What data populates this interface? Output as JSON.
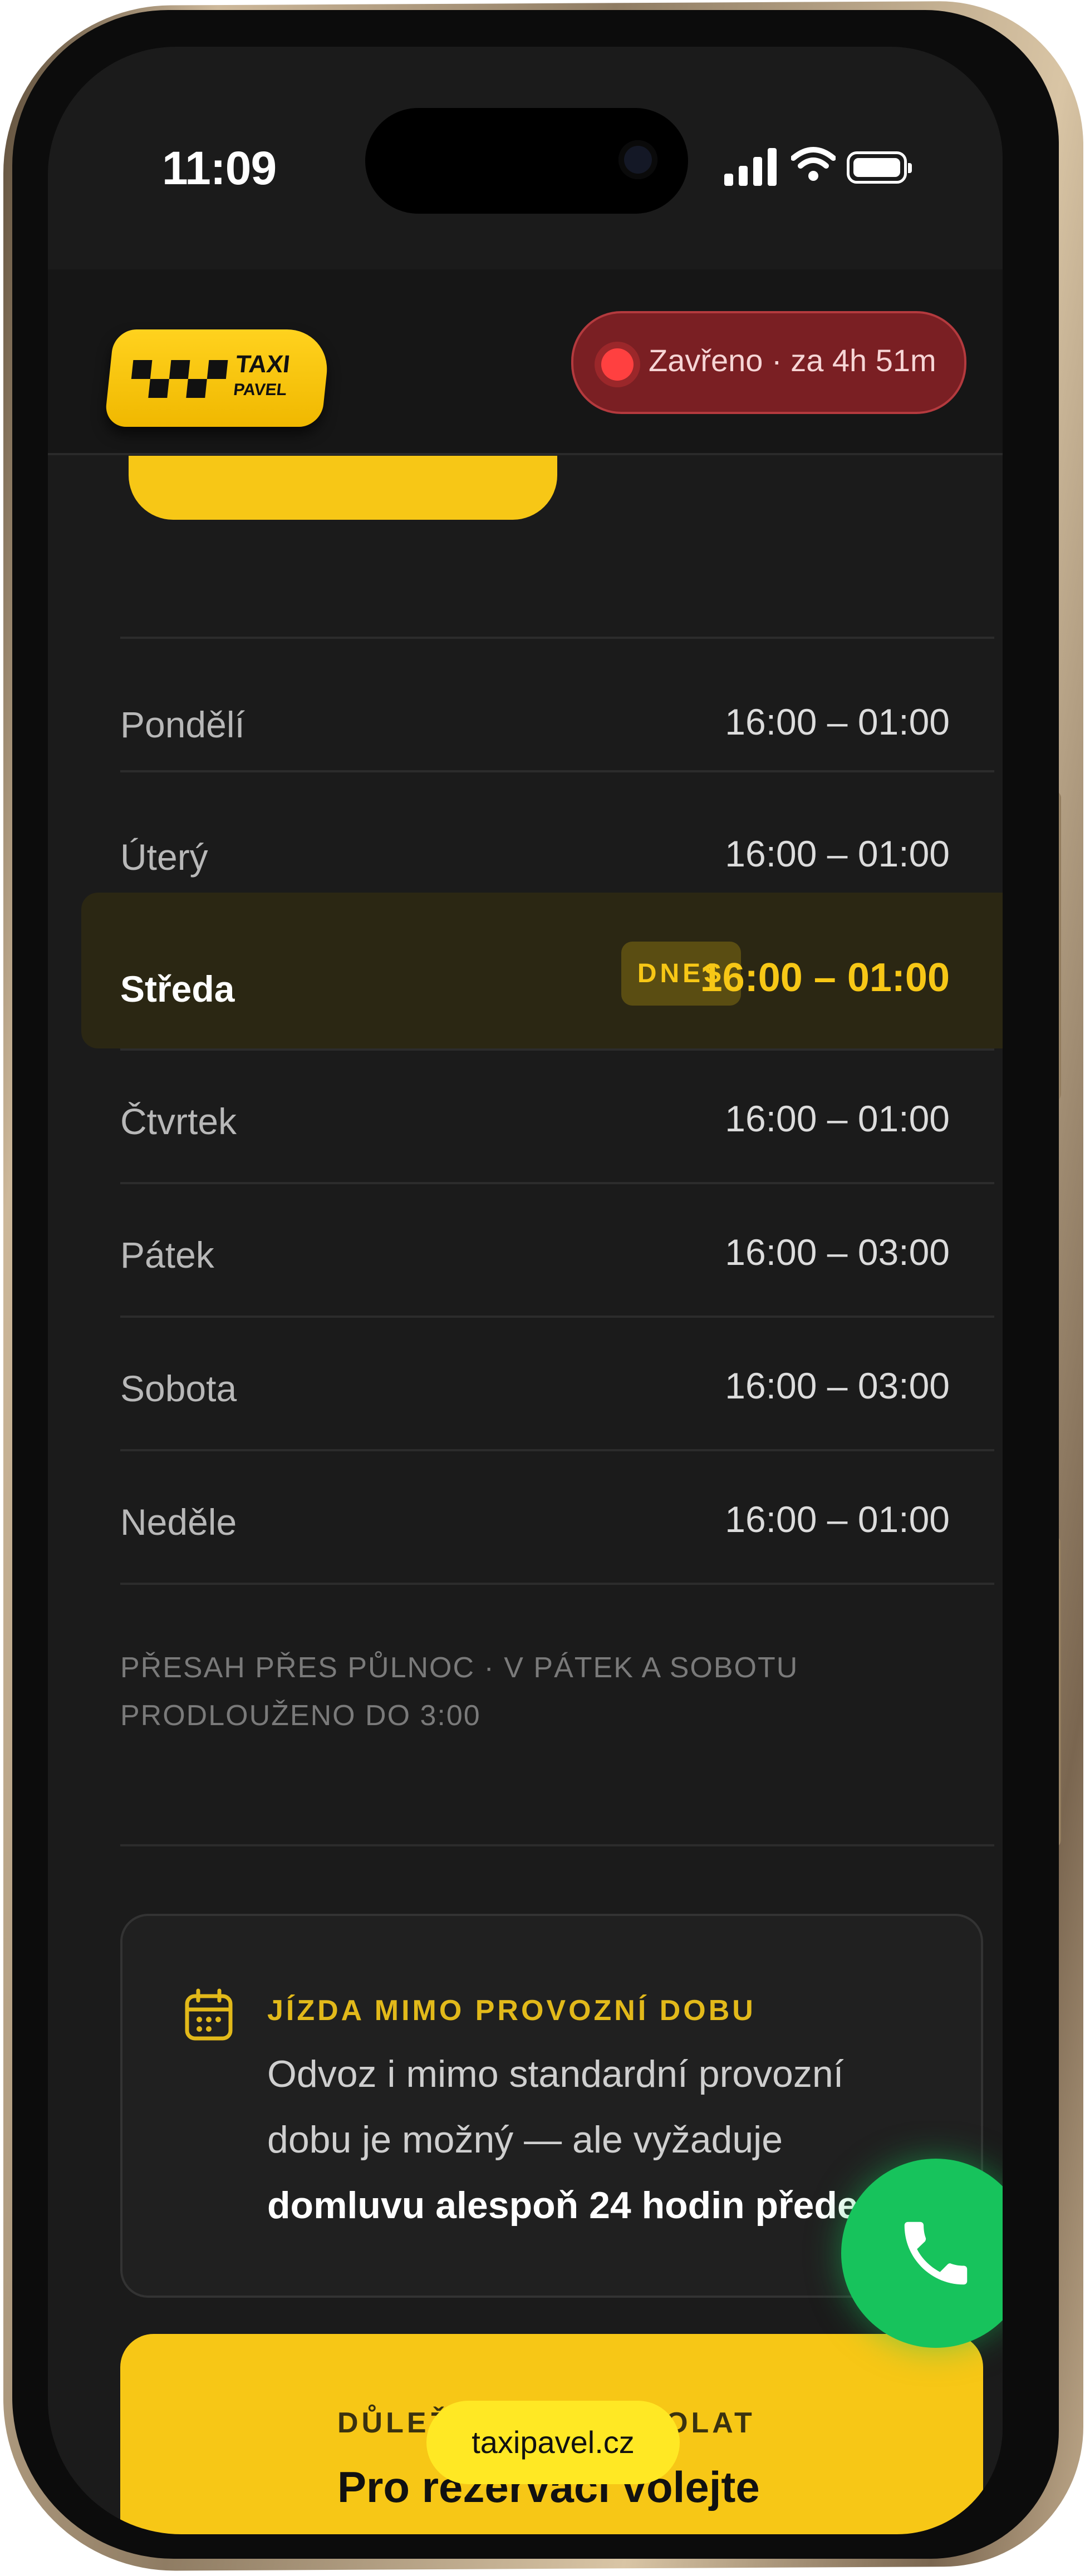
{
  "status_bar": {
    "time": "11:09"
  },
  "header": {
    "logo_line1": "TAXI",
    "logo_line2": "PAVEL",
    "status_label": "Zavřeno · za 4h 51m"
  },
  "hours": {
    "rows": [
      {
        "day": "Pondělí",
        "time": "16:00 – 01:00"
      },
      {
        "day": "Úterý",
        "time": "16:00 – 01:00"
      },
      {
        "day": "Středa",
        "time": "16:00 – 01:00",
        "today": true
      },
      {
        "day": "Čtvrtek",
        "time": "16:00 – 01:00"
      },
      {
        "day": "Pátek",
        "time": "16:00 – 03:00"
      },
      {
        "day": "Sobota",
        "time": "16:00 – 03:00"
      },
      {
        "day": "Neděle",
        "time": "16:00 – 01:00"
      }
    ],
    "today_badge": "DNES",
    "note_line1": "PŘESAH PŘES PŮLNOC · V PÁTEK A SOBOTU",
    "note_line2": "PRODLOUŽENO DO 3:00"
  },
  "off_hours_card": {
    "title": "JÍZDA MIMO PROVOZNÍ DOBU",
    "body_line1": "Odvoz i mimo standardní provozní",
    "body_line2": "dobu je možný — ale vyžaduje",
    "body_bold": "domluvu alespoň 24 hodin předem"
  },
  "important_card": {
    "title": "DŮLEŽITÉ — KDY VOLAT",
    "body": "Pro rezervaci volejte"
  },
  "url_bar": {
    "text": "taxipavel.cz"
  },
  "colors": {
    "accent": "#f7c716",
    "closed": "#ff4040",
    "call": "#17c35c",
    "background": "#1b1b1b"
  }
}
